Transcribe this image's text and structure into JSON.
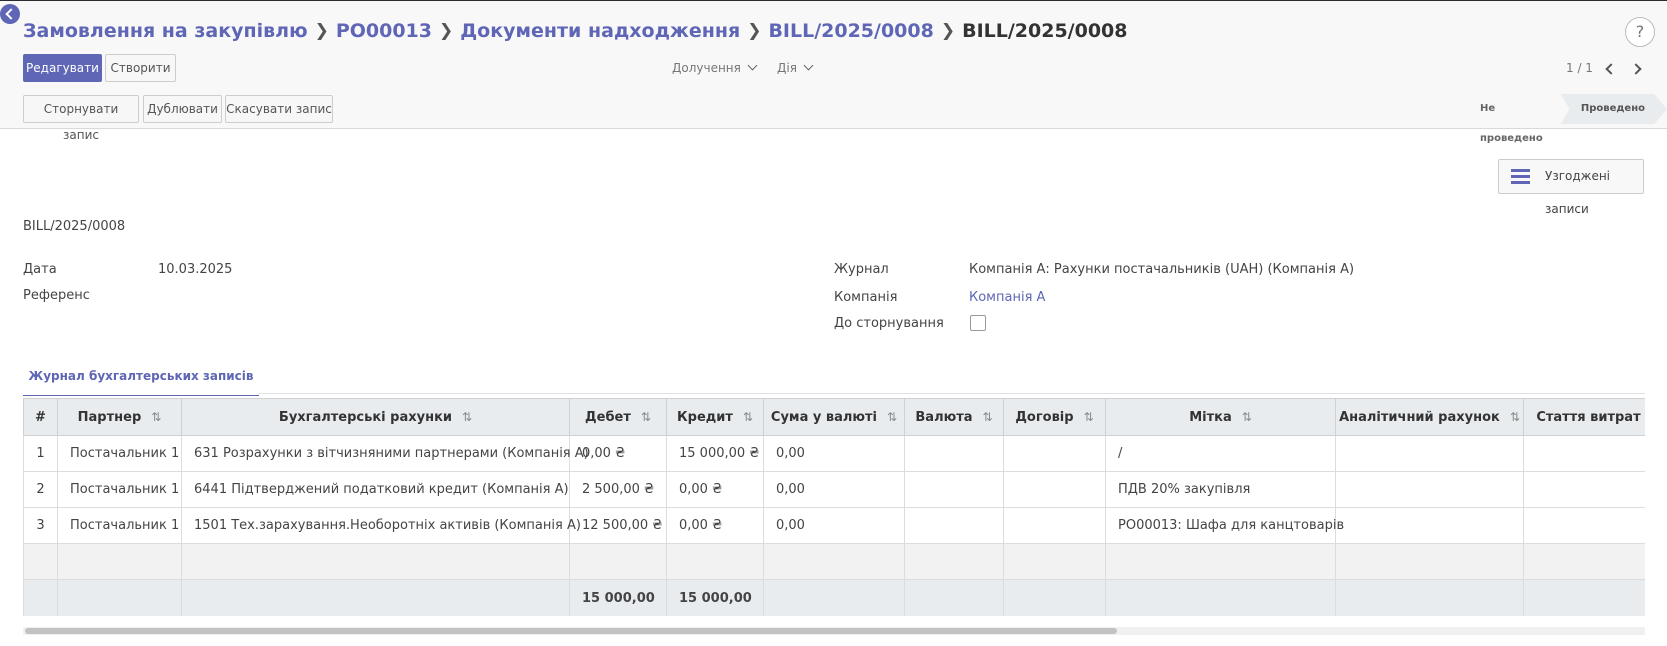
{
  "breadcrumb": [
    {
      "label": "Замовлення на закупівлю"
    },
    {
      "label": "PO00013"
    },
    {
      "label": "Документи надходження"
    },
    {
      "label": "BILL/2025/0008"
    }
  ],
  "breadcrumb_current": "BILL/2025/0008",
  "help_label": "?",
  "buttons": {
    "edit": "Редагувати",
    "create": "Створити"
  },
  "dropdowns": {
    "attachments": "Долучення",
    "action": "Дія"
  },
  "pager": {
    "value": "1 / 1"
  },
  "action_buttons": {
    "reverse": "Сторнувати запис",
    "duplicate": "Дублювати",
    "cancel": "Скасувати запис"
  },
  "statusbar": {
    "draft": "Не проведено",
    "posted": "Проведено"
  },
  "reconciled_button": "Узгоджені записи",
  "record_name": "BILL/2025/0008",
  "form": {
    "date_label": "Дата",
    "date_value": "10.03.2025",
    "ref_label": "Референс",
    "journal_label": "Журнал",
    "journal_value": "Компанія А: Рахунки постачальників (UAH) (Компанія А)",
    "company_label": "Компанія",
    "company_value": "Компанія А",
    "reversal_label": "До сторнування"
  },
  "tab_label": "Журнал бухгалтерських записів",
  "table": {
    "headers": [
      "#",
      "Партнер",
      "Бухгалтерські рахунки",
      "Дебет",
      "Кредит",
      "Сума у валюті",
      "Валюта",
      "Договір",
      "Мітка",
      "Аналітичний рахунок",
      "Стаття витрат"
    ],
    "rows": [
      [
        "1",
        "Постачальник 1",
        "631 Розрахунки з вітчизняними партнерами (Компанія А)",
        "0,00 ₴",
        "15 000,00 ₴",
        "0,00",
        "",
        "",
        "/",
        "",
        ""
      ],
      [
        "2",
        "Постачальник 1",
        "6441 Підтверджений податковий кредит (Компанія А)",
        "2 500,00 ₴",
        "0,00 ₴",
        "0,00",
        "",
        "",
        "ПДВ 20% закупівля",
        "",
        ""
      ],
      [
        "3",
        "Постачальник 1",
        "1501 Тех.зарахування.Необоротніх активів (Компанія А)",
        "12 500,00 ₴",
        "0,00 ₴",
        "0,00",
        "",
        "",
        "PO00013: Шафа для канцтоварів",
        "",
        ""
      ]
    ],
    "totals": {
      "debit": "15 000,00",
      "credit": "15 000,00"
    }
  },
  "colors": {
    "accent": "#5e66b5",
    "header_bg": "#e9ecef"
  }
}
